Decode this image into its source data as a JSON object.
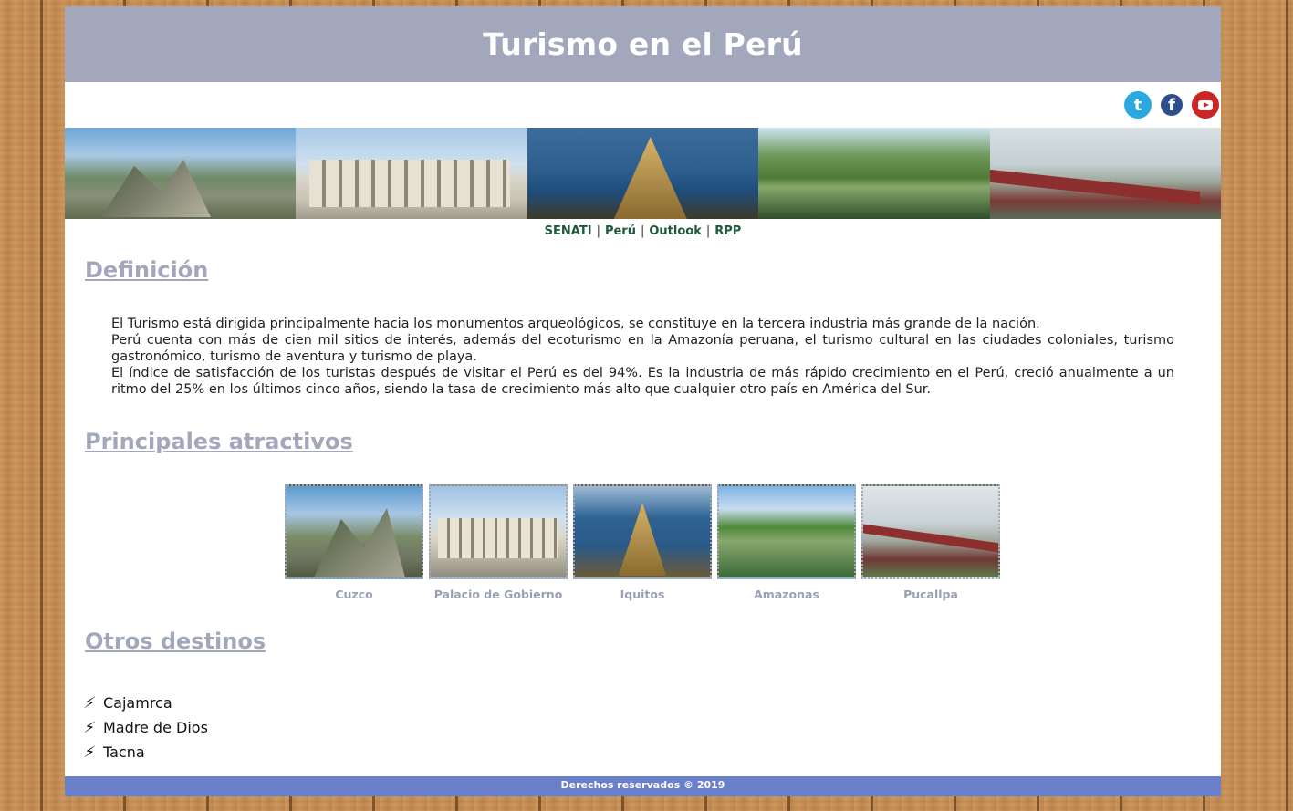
{
  "header": {
    "title": "Turismo en el Perú"
  },
  "social": [
    {
      "name": "twitter",
      "glyph": "t"
    },
    {
      "name": "facebook",
      "glyph": "f"
    },
    {
      "name": "youtube",
      "glyph": ""
    }
  ],
  "nav": {
    "links": [
      "SENATI",
      "Perú",
      "Outlook",
      "RPP"
    ],
    "separator": "|"
  },
  "definicion": {
    "title": "Definición",
    "paragraphs": [
      "El Turismo está dirigida principalmente hacia los monumentos arqueológicos, se constituye en la tercera industria más grande de la nación.",
      "Perú cuenta con más de cien mil sitios de interés, además del ecoturismo en la Amazonía peruana, el turismo cultural en las ciudades coloniales, turismo gastronómico, turismo de aventura y turismo de playa.",
      "El índice de satisfacción de los turistas después de visitar el Perú es del 94%. Es la industria de más rápido crecimiento en el Perú, creció anualmente a un ritmo del 25% en los últimos cinco años, siendo la tasa de crecimiento más alto que cualquier otro país en América del Sur."
    ]
  },
  "atractivos": {
    "title": "Principales atractivos",
    "items": [
      {
        "caption": "Cuzco"
      },
      {
        "caption": "Palacio de Gobierno"
      },
      {
        "caption": "Iquitos"
      },
      {
        "caption": "Amazonas"
      },
      {
        "caption": "Pucallpa"
      }
    ]
  },
  "destinos": {
    "title": "Otros destinos",
    "bullet_icon": "bolt-icon",
    "items": [
      "Cajamrca",
      "Madre de Dios",
      "Tacna"
    ]
  },
  "footer": {
    "text": "Derechos reservados © 2019"
  }
}
